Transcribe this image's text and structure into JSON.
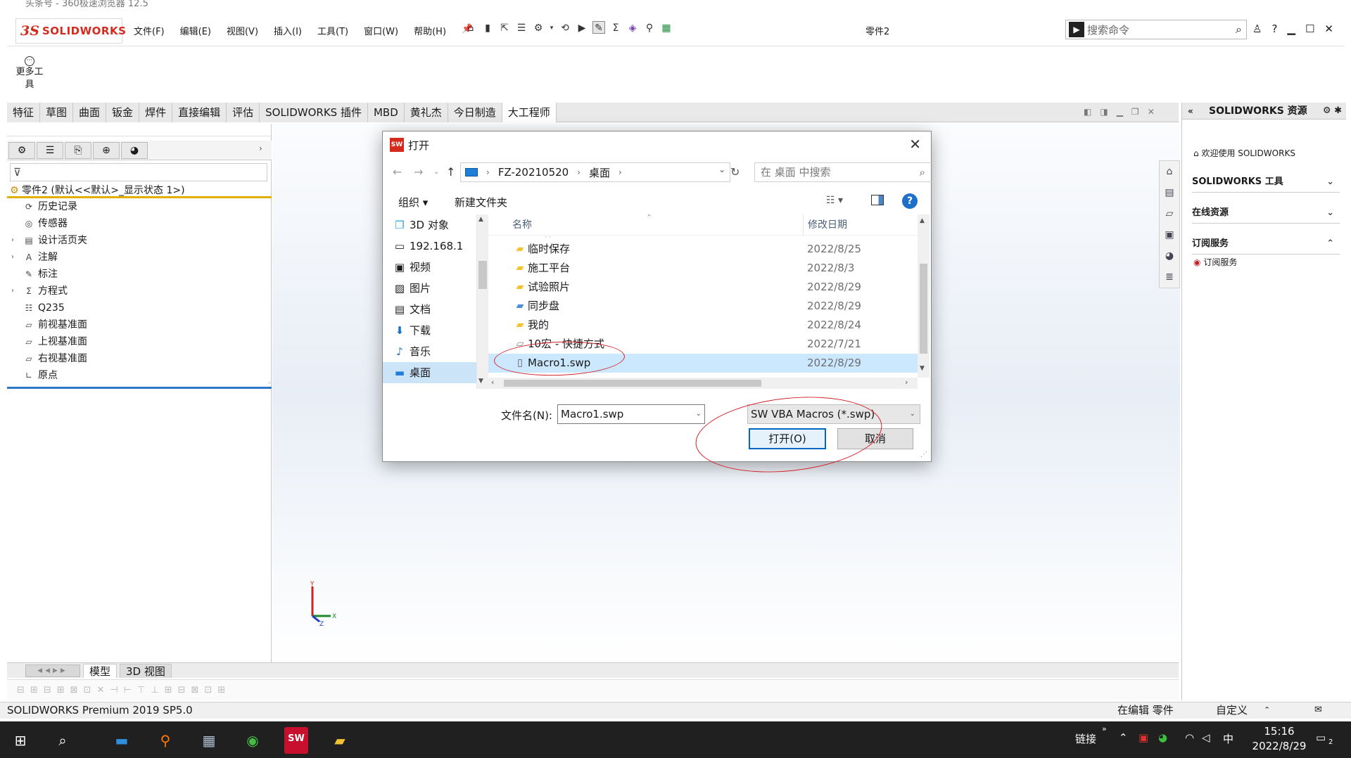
{
  "browser_title": "头条号 - 360极速浏览器 12.5",
  "titlebar": {
    "brand_ds": "3S",
    "brand_text": "SOLIDWORKS",
    "menu": [
      "文件(F)",
      "编辑(E)",
      "视图(V)",
      "插入(I)",
      "工具(T)",
      "窗口(W)",
      "帮助(H)"
    ],
    "doc_title": "零件2",
    "search_placeholder": "搜索命令"
  },
  "more_tools": "更多工具",
  "command_tabs": [
    "特征",
    "草图",
    "曲面",
    "钣金",
    "焊件",
    "直接编辑",
    "评估",
    "SOLIDWORKS 插件",
    "MBD",
    "黄礼杰",
    "今日制造",
    "大工程师"
  ],
  "active_command_tab": "大工程师",
  "feature_tree": {
    "root": "零件2 (默认<<默认>_显示状态 1>)",
    "items": [
      {
        "label": "历史记录",
        "icon": "history-icon",
        "expandable": false
      },
      {
        "label": "传感器",
        "icon": "sensor-icon",
        "expandable": false
      },
      {
        "label": "设计活页夹",
        "icon": "binder-icon",
        "expandable": true
      },
      {
        "label": "注解",
        "icon": "annotation-icon",
        "expandable": true
      },
      {
        "label": "标注",
        "icon": "markup-icon",
        "expandable": false
      },
      {
        "label": "方程式",
        "icon": "equation-icon",
        "expandable": true
      },
      {
        "label": "Q235",
        "icon": "material-icon",
        "expandable": false
      },
      {
        "label": "前视基准面",
        "icon": "plane-icon",
        "expandable": false
      },
      {
        "label": "上视基准面",
        "icon": "plane-icon",
        "expandable": false
      },
      {
        "label": "右视基准面",
        "icon": "plane-icon",
        "expandable": false
      },
      {
        "label": "原点",
        "icon": "origin-icon",
        "expandable": false
      }
    ]
  },
  "model_tabs": [
    "模型",
    "3D 视图"
  ],
  "status": {
    "version": "SOLIDWORKS Premium 2019 SP5.0",
    "editing": "在编辑 零件",
    "custom": "自定义"
  },
  "resources": {
    "title": "SOLIDWORKS 资源",
    "welcome": "欢迎使用 SOLIDWORKS",
    "sections": [
      "SOLIDWORKS 工具",
      "在线资源",
      "订阅服务"
    ],
    "subscription_item": "订阅服务"
  },
  "dialog": {
    "title": "打开",
    "breadcrumb": [
      "FZ-20210520",
      "桌面"
    ],
    "search_placeholder": "在 桌面 中搜索",
    "organize": "组织 ▾",
    "new_folder": "新建文件夹",
    "nav_items": [
      {
        "label": "3D 对象",
        "icon": "3d-objects-icon",
        "selected": false
      },
      {
        "label": "192.168.1",
        "icon": "network-drive-icon",
        "selected": false
      },
      {
        "label": "视频",
        "icon": "video-icon",
        "selected": false
      },
      {
        "label": "图片",
        "icon": "pictures-icon",
        "selected": false
      },
      {
        "label": "文档",
        "icon": "documents-icon",
        "selected": false
      },
      {
        "label": "下载",
        "icon": "downloads-icon",
        "selected": false
      },
      {
        "label": "音乐",
        "icon": "music-icon",
        "selected": false
      },
      {
        "label": "桌面",
        "icon": "desktop-icon",
        "selected": true
      }
    ],
    "columns": {
      "name": "名称",
      "date": "修改日期"
    },
    "files": [
      {
        "name": "临时保存",
        "date": "2022/8/25",
        "type": "folder",
        "selected": false
      },
      {
        "name": "施工平台",
        "date": "2022/8/3",
        "type": "folder",
        "selected": false
      },
      {
        "name": "试验照片",
        "date": "2022/8/29",
        "type": "folder",
        "selected": false
      },
      {
        "name": "同步盘",
        "date": "2022/8/29",
        "type": "sync-folder",
        "selected": false
      },
      {
        "name": "我的",
        "date": "2022/8/24",
        "type": "folder",
        "selected": false
      },
      {
        "name": "10宏 - 快捷方式",
        "date": "2022/7/21",
        "type": "shortcut",
        "selected": false
      },
      {
        "name": "Macro1.swp",
        "date": "2022/8/29",
        "type": "file",
        "selected": true
      }
    ],
    "filename_label": "文件名(N):",
    "filename_value": "Macro1.swp",
    "filetype_value": "SW VBA Macros (*.swp)",
    "open_button": "打开(O)",
    "cancel_button": "取消"
  },
  "taskbar": {
    "links": "链接",
    "ime": "中",
    "time": "15:16",
    "date": "2022/8/29",
    "notifications": "2"
  },
  "colors": {
    "brand_red": "#d52b1e",
    "selection_blue": "#cce8ff",
    "annotation_red": "#d4202a",
    "taskbar": "#202020"
  }
}
